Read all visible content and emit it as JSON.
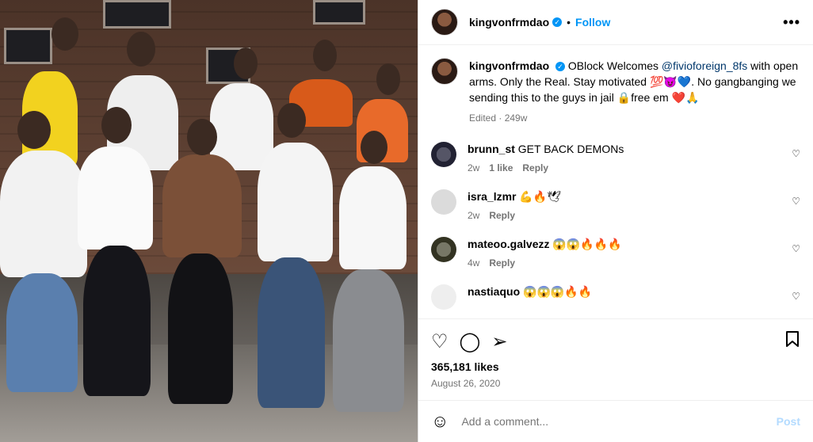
{
  "post": {
    "username": "kingvonfrmdao",
    "follow_label": "Follow",
    "more_label": "•••",
    "caption_prefix": "OBlock Welcomes ",
    "caption_mention": "@fivioforeign_8fs",
    "caption_suffix": " with open arms. Only the Real. Stay motivated 💯😈💙. No gangbanging we sending this to the guys in jail 🔒free em ❤️🙏",
    "edited": "Edited · 249w",
    "likes": "365,181 likes",
    "date": "August 26, 2020"
  },
  "comments": [
    {
      "user": "brunn_st",
      "text": "GET BACK DEMONs",
      "time": "2w",
      "likes": "1 like",
      "reply": "Reply"
    },
    {
      "user": "isra_lzmr",
      "text": "💪🔥🕊",
      "time": "2w",
      "reply": "Reply"
    },
    {
      "user": "mateoo.galvezz",
      "text": "😱😱🔥🔥🔥",
      "time": "4w",
      "reply": "Reply"
    },
    {
      "user": "nastiaquo",
      "text": "😱😱😱🔥🔥"
    }
  ],
  "add_comment": {
    "placeholder": "Add a comment...",
    "post_label": "Post"
  },
  "icons": {
    "like": "heart-icon",
    "comment": "comment-icon",
    "share": "share-icon",
    "save": "bookmark-icon",
    "emoji": "emoji-icon"
  },
  "colors": {
    "accent": "#0095f6",
    "mention": "#00376b",
    "muted": "#737373"
  }
}
